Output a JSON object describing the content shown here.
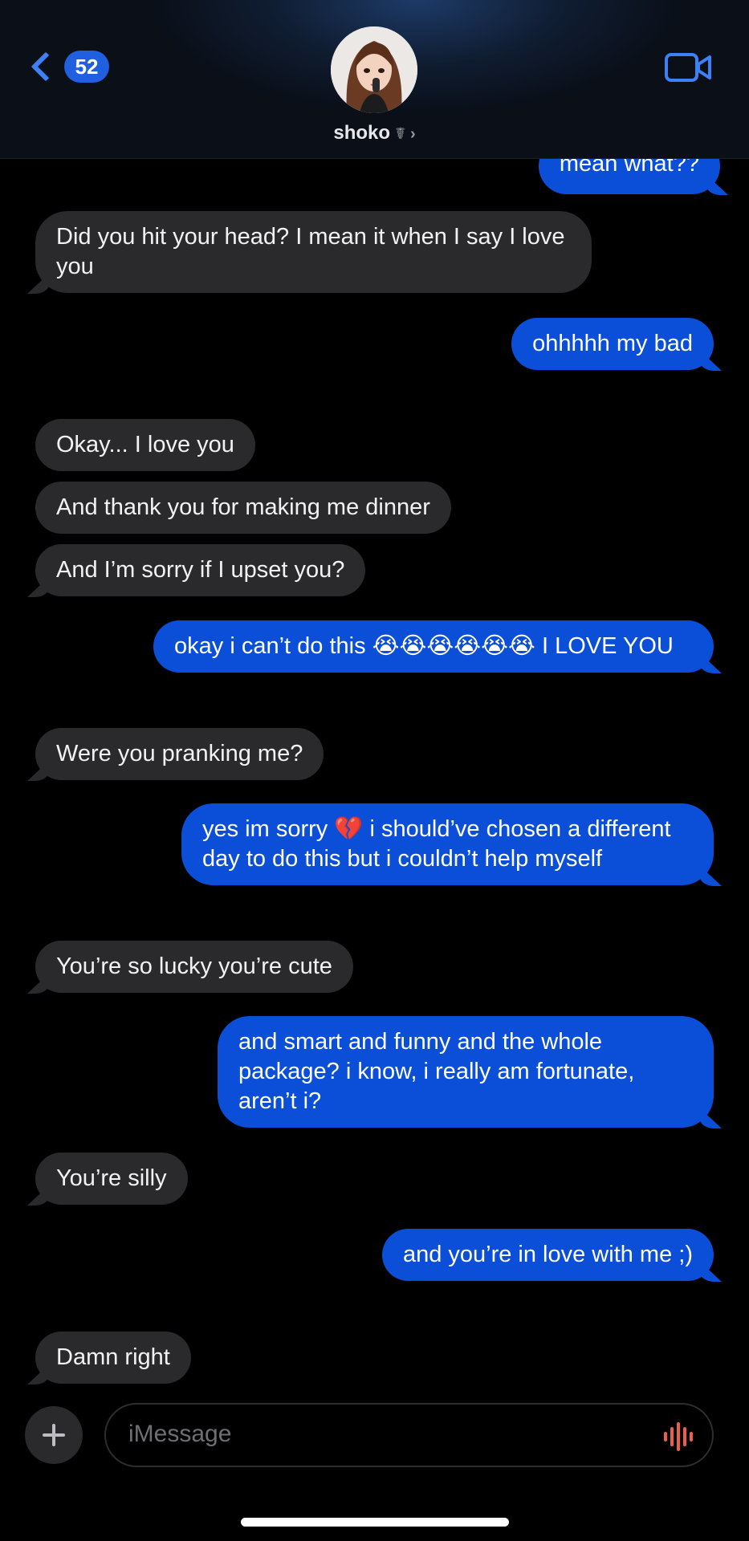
{
  "header": {
    "back_count": "52",
    "contact_name": "shoko",
    "contact_suffix": "☤ ›"
  },
  "colors": {
    "incoming_bubble": "#2a2a2c",
    "outgoing_bubble": "#0b4fd9",
    "accent": "#3c82f6",
    "audio_icon": "#e8604c"
  },
  "messages": [
    {
      "from": "me",
      "text": "mean what??"
    },
    {
      "from": "them",
      "text": "Did you hit your head? I mean it when I say I love you"
    },
    {
      "from": "me",
      "text": "ohhhhh my bad"
    },
    {
      "from": "them",
      "text": "Okay... I love you"
    },
    {
      "from": "them",
      "text": "And thank you for making me dinner"
    },
    {
      "from": "them",
      "text": "And I’m sorry if I upset you?"
    },
    {
      "from": "me",
      "text": "okay i can’t do this 😭😭😭😭😭😭 I LOVE YOU"
    },
    {
      "from": "them",
      "text": "Were you pranking me?"
    },
    {
      "from": "me",
      "text": "yes im sorry 💔 i should’ve chosen a different day to do this but i couldn’t help myself"
    },
    {
      "from": "them",
      "text": "You’re so lucky you’re cute"
    },
    {
      "from": "me",
      "text": "and smart and funny and the whole package? i know, i really am fortunate, aren’t i?"
    },
    {
      "from": "them",
      "text": "You’re silly"
    },
    {
      "from": "me",
      "text": "and you’re in love with me ;)"
    },
    {
      "from": "them",
      "text": "Damn right"
    }
  ],
  "composer": {
    "placeholder": "iMessage",
    "plus_icon": "plus-icon",
    "audio_icon": "audio-waveform-icon"
  }
}
